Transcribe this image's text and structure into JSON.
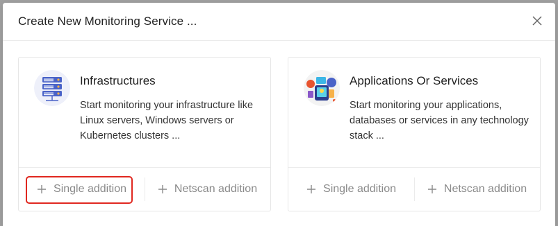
{
  "dialog": {
    "title": "Create New Monitoring Service ..."
  },
  "cards": [
    {
      "title": "Infrastructures",
      "icon": "server-rack-icon",
      "description": "Start monitoring your infrastructure like Linux servers, Windows servers or Kubernetes clusters ...",
      "buttons": {
        "single": "Single addition",
        "netscan": "Netscan addition"
      }
    },
    {
      "title": "Applications Or Services",
      "icon": "applications-icon",
      "description": "Start monitoring your applications, databases or services in any technology stack ...",
      "buttons": {
        "single": "Single addition",
        "netscan": "Netscan addition"
      }
    }
  ],
  "colors": {
    "highlight": "#e0271f",
    "muted_text": "#8a8a8a",
    "icon_blue": "#4a63c8"
  }
}
